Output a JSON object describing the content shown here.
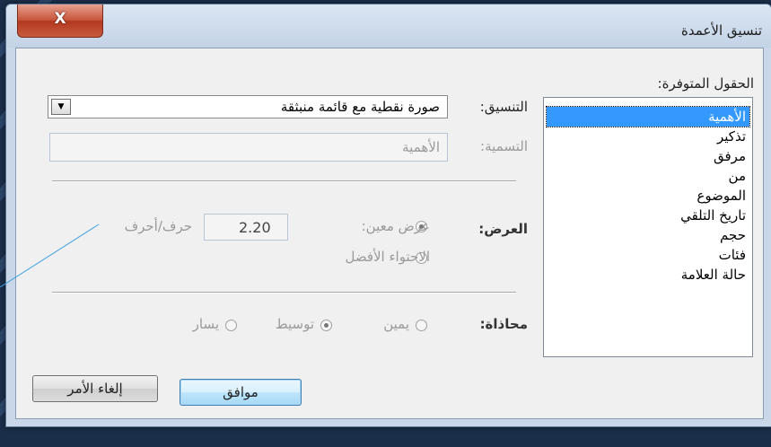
{
  "dialog": {
    "title": "تنسيق الأعمدة",
    "close_label": "X"
  },
  "available_fields": {
    "label": "الحقول المتوفرة:",
    "items": [
      "الأهمية",
      "تذكير",
      "مرفق",
      "من",
      "الموضوع",
      "تاريخ التلقي",
      "حجم",
      "فئات",
      "حالة العلامة"
    ],
    "selected": "الأهمية"
  },
  "format": {
    "label": "التنسيق:",
    "value": "صورة نقطية مع قائمة منبثقة"
  },
  "caption": {
    "label": "التسمية:",
    "value": "الأهمية"
  },
  "width": {
    "label": "العرض:",
    "specific_label": "عرض معين:",
    "specific_value": "2.20",
    "unit": "حرف/أحرف",
    "best_fit_label": "الاحتواء الأفضل",
    "selected": "specific"
  },
  "alignment": {
    "label": "محاذاة:",
    "right": "يمين",
    "center": "توسيط",
    "left": "يسار",
    "selected": "center"
  },
  "buttons": {
    "ok": "موافق",
    "cancel": "إلغاء الأمر"
  },
  "colors": {
    "selection": "#3399ff",
    "background": "#1b2e49",
    "close": "#c7553b"
  }
}
